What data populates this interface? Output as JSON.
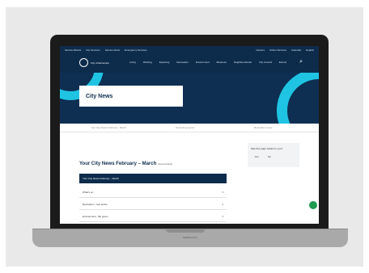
{
  "utility_bar": {
    "left_links": [
      "Service Alberta",
      "City Services",
      "Service Alerts",
      "Emergency Services"
    ],
    "right_links": [
      "Careers",
      "Online Services",
      "Calendar"
    ],
    "language": "English"
  },
  "header": {
    "logo_text": "City of Edmonton",
    "nav_items": [
      "Living",
      "Working",
      "Exploring",
      "Recreation",
      "Environment",
      "Business",
      "Neighbourhoods",
      "City Council",
      "Events"
    ],
    "search_icon": "search-icon"
  },
  "hero": {
    "title": "City News",
    "accent_color": "#1fc4e3",
    "background_color": "#0e2f52"
  },
  "subnav": {
    "items": [
      "Your City News February - March",
      "Upcoming events",
      "Recreation news"
    ]
  },
  "sidebar": {
    "question": "Was this page helpful to you?",
    "yes_label": "Yes",
    "no_label": "No"
  },
  "content": {
    "title": "Your City News February – March",
    "title_suffix": "(Read article)",
    "accordion_header": "Your City News February – March",
    "rows": [
      "What's on",
      "Recreation - Get active",
      "Environment - Be green"
    ]
  },
  "laptop_brand": "MacBook Pro"
}
